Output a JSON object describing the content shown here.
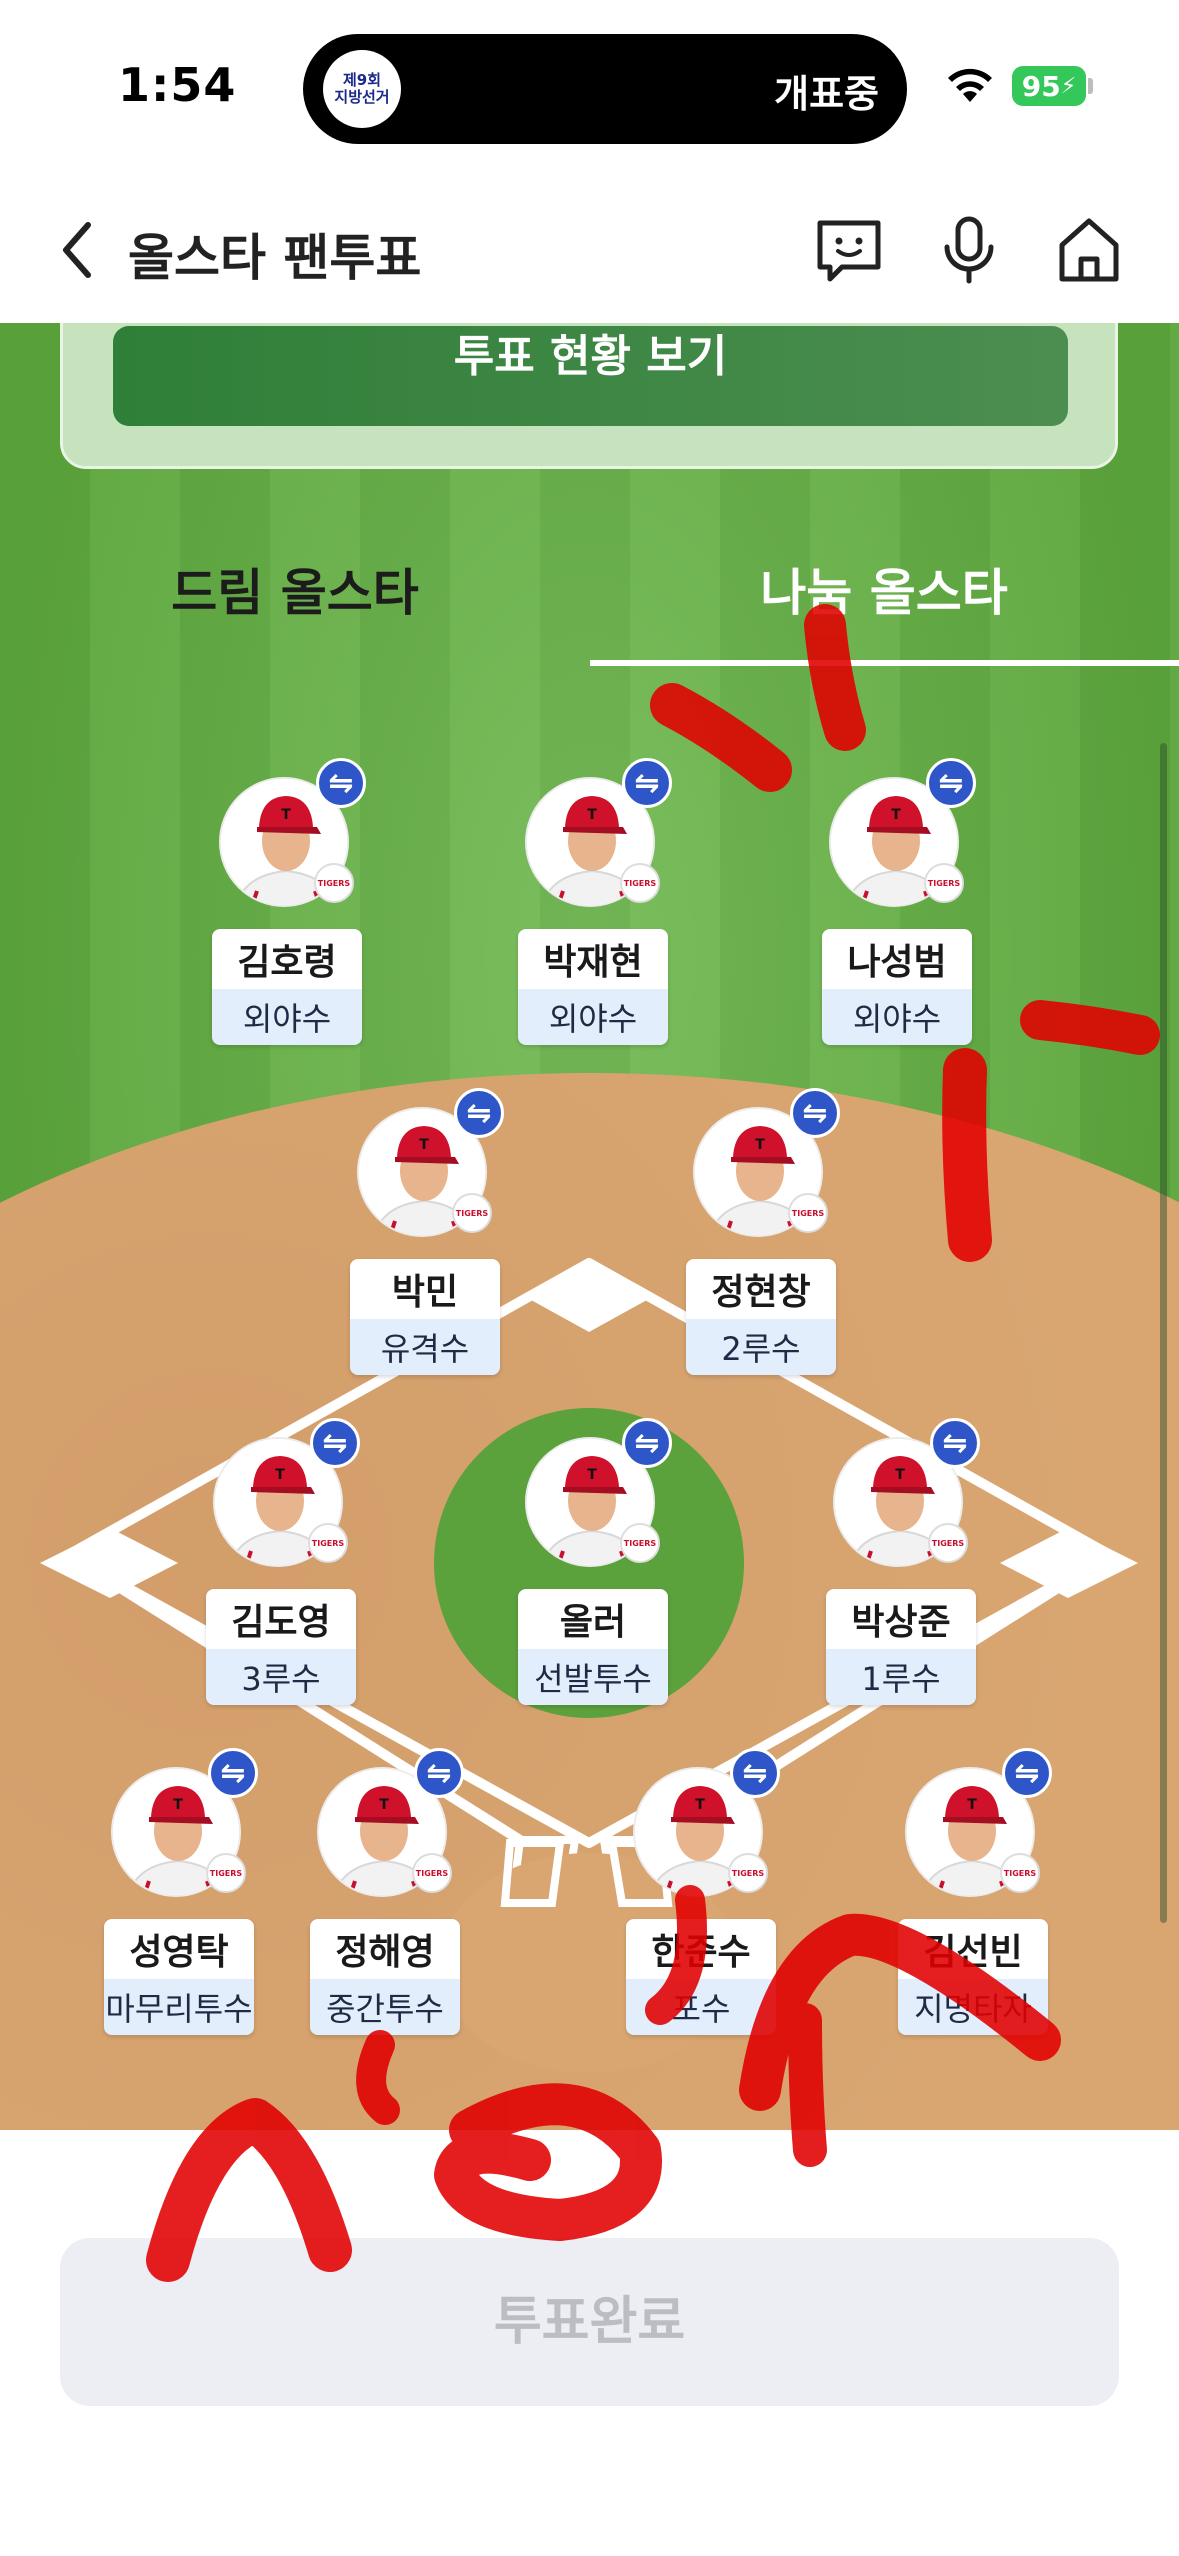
{
  "status_bar": {
    "time": "1:54",
    "island_logo_line1": "제9회",
    "island_logo_line2": "지방선거",
    "island_text": "개표중",
    "battery": "95"
  },
  "header": {
    "title": "올스타 팬투표",
    "back_icon": "chevron-left-icon",
    "icons": [
      "chat-face-icon",
      "microphone-icon",
      "home-icon"
    ]
  },
  "vote_status_button": "투표 현황 보기",
  "tabs": [
    {
      "label": "드림 올스타",
      "selected": false
    },
    {
      "label": "나눔 올스타",
      "selected": true
    }
  ],
  "team_badge": "TIGERS",
  "swap_icon": "⇋",
  "players": [
    {
      "name": "김호령",
      "position": "외야수"
    },
    {
      "name": "박재현",
      "position": "외야수"
    },
    {
      "name": "나성범",
      "position": "외야수"
    },
    {
      "name": "박민",
      "position": "유격수"
    },
    {
      "name": "정현창",
      "position": "2루수"
    },
    {
      "name": "김도영",
      "position": "3루수"
    },
    {
      "name": "올러",
      "position": "선발투수"
    },
    {
      "name": "박상준",
      "position": "1루수"
    },
    {
      "name": "성영탁",
      "position": "마무리투수"
    },
    {
      "name": "정해영",
      "position": "중간투수"
    },
    {
      "name": "한준수",
      "position": "포수"
    },
    {
      "name": "김선빈",
      "position": "지명타자"
    }
  ],
  "submit_button": "투표완료",
  "colors": {
    "field_green": "#5eaa3e",
    "infield_dirt": "#d9a672",
    "swap_blue": "#2e56c8",
    "vote_button_green": "#2f7f38",
    "scribble_red": "#e10000",
    "battery_green": "#34c759"
  }
}
